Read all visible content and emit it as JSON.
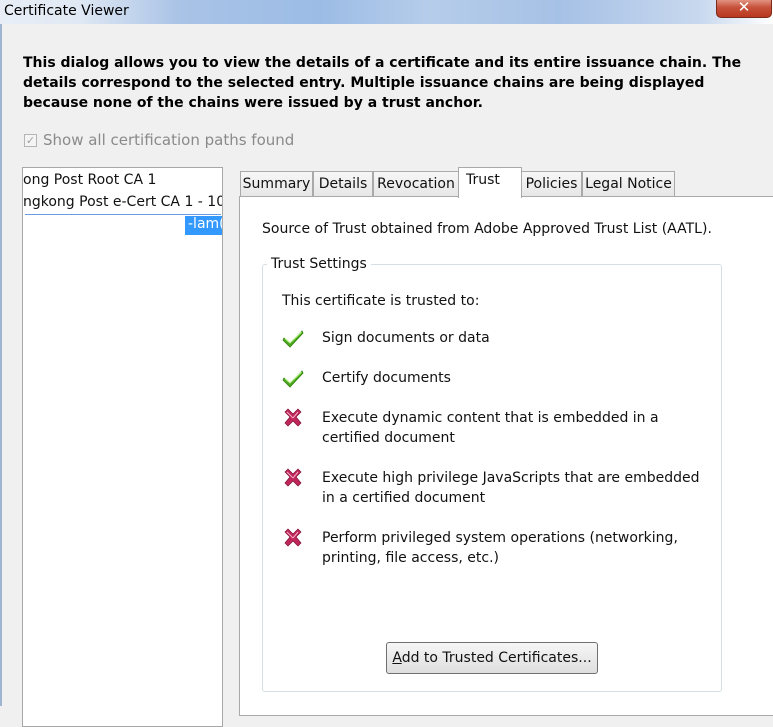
{
  "window": {
    "title": "Certificate Viewer"
  },
  "description": "This dialog allows you to view the details of a certificate and its entire issuance chain. The details correspond to the selected entry. Multiple issuance chains are being displayed because none of the chains were issued by a trust anchor.",
  "show_all_paths": {
    "label": "Show all certification paths found",
    "checked": true
  },
  "tree": {
    "items": [
      "ong Post Root CA 1",
      "ngkong Post e-Cert CA 1 - 10"
    ],
    "selected": "-lam("
  },
  "tabs": [
    "Summary",
    "Details",
    "Revocation",
    "Trust",
    "Policies",
    "Legal Notice"
  ],
  "active_tab": "Trust",
  "trust": {
    "source": "Source of Trust obtained from Adobe Approved Trust List (AATL).",
    "group_title": "Trust Settings",
    "trusted_to": "This certificate is trusted to:",
    "permissions": [
      {
        "text": "Sign documents or data",
        "allowed": true
      },
      {
        "text": "Certify documents",
        "allowed": true
      },
      {
        "text": "Execute dynamic content that is embedded in a certified document",
        "allowed": false
      },
      {
        "text": "Execute high privilege JavaScripts that are embedded in a certified document",
        "allowed": false
      },
      {
        "text": "Perform privileged system operations (networking, printing, file access, etc.)",
        "allowed": false
      }
    ],
    "add_button": {
      "accel": "A",
      "rest": "dd to Trusted Certificates..."
    }
  },
  "colors": {
    "check": "#4caf1a",
    "cross": "#c0265a",
    "selection": "#3399ff"
  }
}
